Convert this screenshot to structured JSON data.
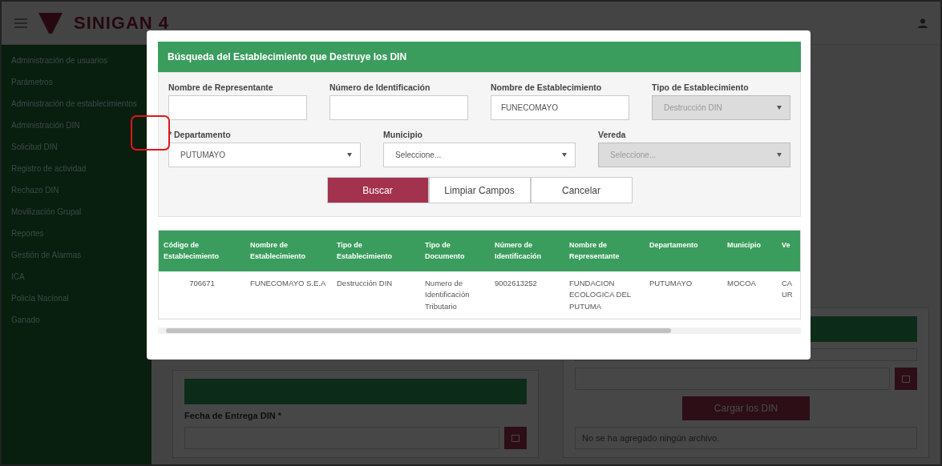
{
  "header": {
    "logo": "SINIGAN 4"
  },
  "sidebar": {
    "items": [
      {
        "label": "Administración de usuarios"
      },
      {
        "label": "Parámetros"
      },
      {
        "label": "Administración de establecimientos"
      },
      {
        "label": "Administración DIN"
      },
      {
        "label": "Solicitud DIN"
      },
      {
        "label": "Registro de actividad"
      },
      {
        "label": "Rechazo DIN"
      },
      {
        "label": "Movilización Grupal"
      },
      {
        "label": "Reportes"
      },
      {
        "label": "Gestión de Alarmas"
      },
      {
        "label": "ICA"
      },
      {
        "label": "Policía Nacional"
      },
      {
        "label": "Ganado"
      }
    ]
  },
  "background": {
    "left_card": {
      "date_label": "Fecha de Entrega DIN *"
    },
    "right_card": {
      "upload_button": "Cargar los DIN",
      "file_status": "No se ha agregado ningún archivo."
    }
  },
  "modal": {
    "title": "Búsqueda del Establecimiento que Destruye los DIN",
    "rows": [
      {
        "fields": [
          {
            "kind": "text",
            "label": "Nombre de Representante",
            "disabled": false
          },
          {
            "kind": "text",
            "label": "Número de Identificación",
            "disabled": false
          },
          {
            "kind": "text",
            "label": "Nombre de Establecimiento",
            "value": "FUNECOMAYO",
            "disabled": false
          },
          {
            "kind": "select",
            "label": "Tipo de Establecimiento",
            "value": "Destrucción DIN",
            "disabled": true
          }
        ]
      },
      {
        "fields": [
          {
            "kind": "select",
            "label": "* Departamento",
            "value": "PUTUMAYO",
            "disabled": false
          },
          {
            "kind": "select",
            "label": "Municipio",
            "value": "Seleccione...",
            "disabled": false
          },
          {
            "kind": "select",
            "label": "Vereda",
            "value": "Seleccione...",
            "disabled": true
          }
        ]
      }
    ],
    "buttons": [
      {
        "kind": "primary",
        "label": "Buscar"
      },
      {
        "kind": "default",
        "label": "Limpiar Campos"
      },
      {
        "kind": "default",
        "label": "Cancelar"
      }
    ],
    "table": {
      "columns": [
        "Código de Establecimiento",
        "Nombre de Establecimiento",
        "Tipo de Establecimiento",
        "Tipo de Documento",
        "Número de Identificación",
        "Nombre de Representante",
        "Departamento",
        "Municipio",
        "Ve"
      ],
      "rows": [
        [
          "706671",
          "FUNECOMAYO S.E.A",
          "Destrucción DIN",
          "Numero de Identificación Tributario",
          "9002613252",
          "FUNDACION ECOLOGICA DEL PUTUMA",
          "PUTUMAYO",
          "MOCOA",
          "CA UR"
        ]
      ]
    }
  },
  "annotation": {
    "kind": "frame"
  }
}
